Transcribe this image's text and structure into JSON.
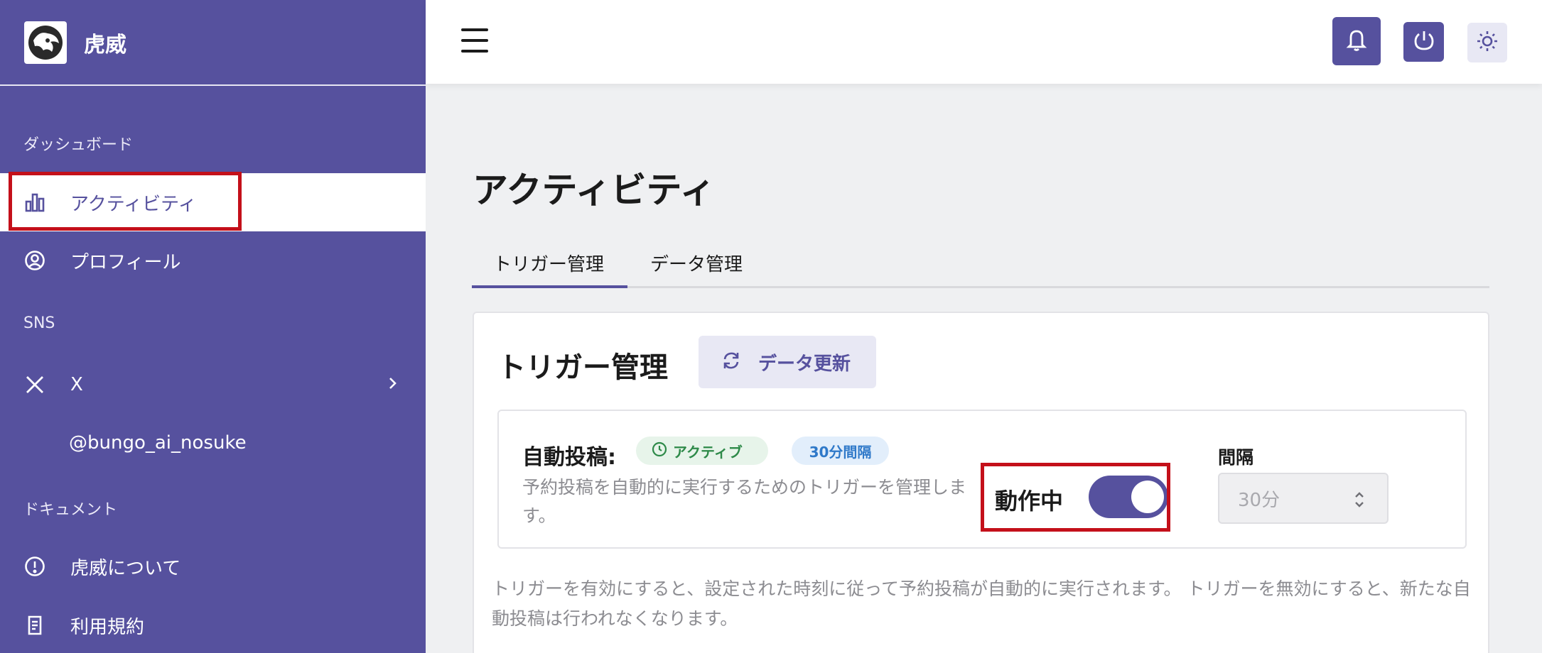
{
  "sidebar": {
    "brand": "虎威",
    "sections": {
      "dashboard": "ダッシュボード",
      "sns": "SNS",
      "documents": "ドキュメント"
    },
    "items": {
      "activity": "アクティビティ",
      "profile": "プロフィール",
      "x": "X",
      "x_account": "@bungo_ai_nosuke",
      "about": "虎威について",
      "terms": "利用規約"
    }
  },
  "topbar": {
    "icons": [
      "menu-icon",
      "bell-icon",
      "power-icon",
      "sun-icon"
    ]
  },
  "main": {
    "title": "アクティビティ",
    "tabs": [
      "トリガー管理",
      "データ管理"
    ],
    "active_tab": 0,
    "card": {
      "title": "トリガー管理",
      "refresh_label": "データ更新",
      "auto_post_label": "自動投稿:",
      "status_badge": "アクティブ",
      "interval_badge": "30分間隔",
      "description": "予約投稿を自動的に実行するためのトリガーを管理します。",
      "running_label": "動作中",
      "toggle_on": true,
      "interval_label": "間隔",
      "interval_value": "30分",
      "footer": "トリガーを有効にすると、設定された時刻に従って予約投稿が自動的に実行されます。 トリガーを無効にすると、新たな自動投稿は行われなくなります。"
    }
  },
  "colors": {
    "brand": "#56519e",
    "highlight": "#c4101a",
    "badge_active": "#2e8a49",
    "badge_interval": "#2f79c9"
  }
}
